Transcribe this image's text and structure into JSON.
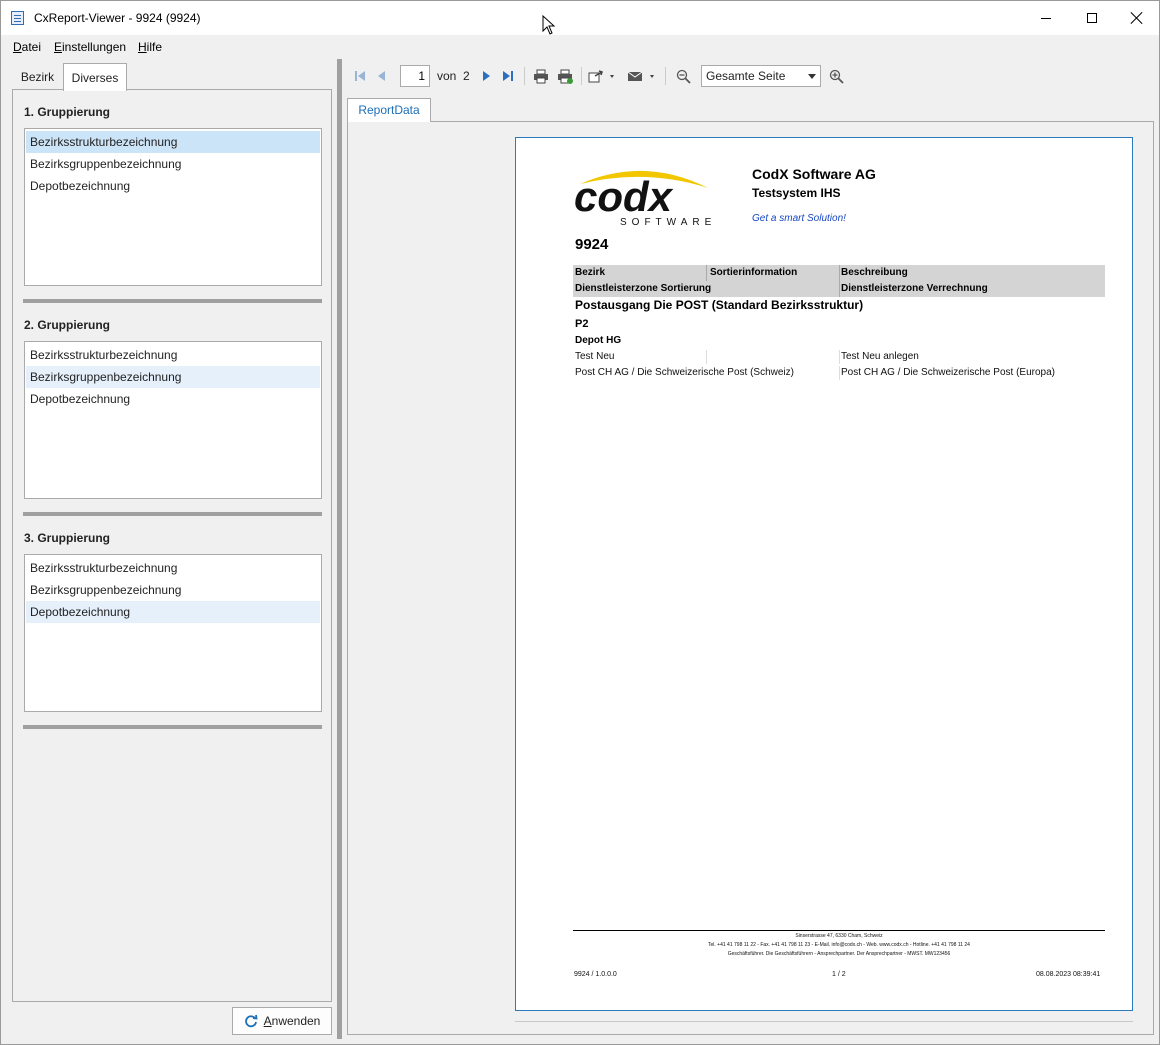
{
  "window": {
    "title": "CxReport-Viewer - 9924 (9924)"
  },
  "menu": {
    "items": [
      "Datei",
      "Einstellungen",
      "Hilfe"
    ]
  },
  "left_tabs": [
    "Bezirk",
    "Diverses"
  ],
  "groups": [
    {
      "title": "1. Gruppierung",
      "items": [
        "Bezirksstrukturbezeichnung",
        "Bezirksgruppenbezeichnung",
        "Depotbezeichnung"
      ]
    },
    {
      "title": "2. Gruppierung",
      "items": [
        "Bezirksstrukturbezeichnung",
        "Bezirksgruppenbezeichnung",
        "Depotbezeichnung"
      ]
    },
    {
      "title": "3. Gruppierung",
      "items": [
        "Bezirksstrukturbezeichnung",
        "Bezirksgruppenbezeichnung",
        "Depotbezeichnung"
      ]
    }
  ],
  "apply_label": "Anwenden",
  "toolbar": {
    "page": "1",
    "of_label": "von",
    "total": "2",
    "zoom": "Gesamte Seite"
  },
  "report_tab": "ReportData",
  "report": {
    "company": "CodX Software AG",
    "system": "Testsystem IHS",
    "slogan": "Get a smart Solution!",
    "logo_text": "codx",
    "logo_sub": "SOFTWARE",
    "doc_title": "9924",
    "headers_row1": [
      "Bezirk",
      "Sortierinformation",
      "Beschreibung"
    ],
    "headers_row2": [
      "Dienstleisterzone Sortierung",
      "Dienstleisterzone Verrechnung"
    ],
    "section1": "Postausgang Die POST (Standard Bezirksstruktur)",
    "section2": "P2",
    "section3": "Depot HG",
    "row1": [
      "Test Neu",
      "",
      "Test Neu anlegen"
    ],
    "row2": [
      "Post CH AG / Die Schweizerische Post (Schweiz)",
      "Post CH AG / Die Schweizerische Post (Europa)"
    ],
    "footer_lines": [
      "Sinserstrasse 47, 6330 Cham, Schweiz",
      "Tel. +41 41 798 11 22 - Fax. +41 41 798 11 23 - E-Mail. info@codx.ch - Web. www.codx.ch - Hotline. +41 41 798 11 24",
      "Geschäftsführer. Die Geschäftsführern - Ansprechpartner. Der Ansprechpartner - MWST. MW123456"
    ],
    "footer_left": "9924 / 1.0.0.0",
    "footer_center": "1 / 2",
    "footer_right": "08.08.2023 08:39:41"
  }
}
